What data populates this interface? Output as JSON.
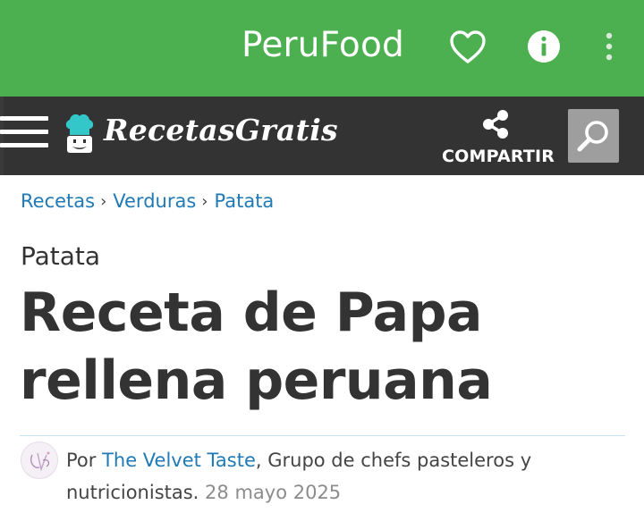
{
  "app_bar": {
    "title": "PeruFood",
    "icons": [
      "heart-icon",
      "info-icon",
      "more-vertical-icon"
    ],
    "color": "#4caf50"
  },
  "site_header": {
    "logo_text": "RecetasGratis",
    "share_label": "COMPARTIR",
    "icons": [
      "menu-icon",
      "chef-hat-icon",
      "share-icon",
      "search-icon"
    ],
    "color": "#333333"
  },
  "breadcrumb": [
    {
      "label": "Recetas"
    },
    {
      "label": "Verduras"
    },
    {
      "label": "Patata"
    }
  ],
  "article": {
    "category": "Patata",
    "title": "Receta de Papa rellena peruana",
    "byline_prefix": "Por ",
    "author": "The Velvet Taste",
    "author_desc_line1": ", Grupo de chefs pasteleros y",
    "author_desc_line2": "nutricionistas.",
    "date": "28 mayo 2025"
  },
  "colors": {
    "link": "#1f7ab5",
    "text": "#333333"
  }
}
